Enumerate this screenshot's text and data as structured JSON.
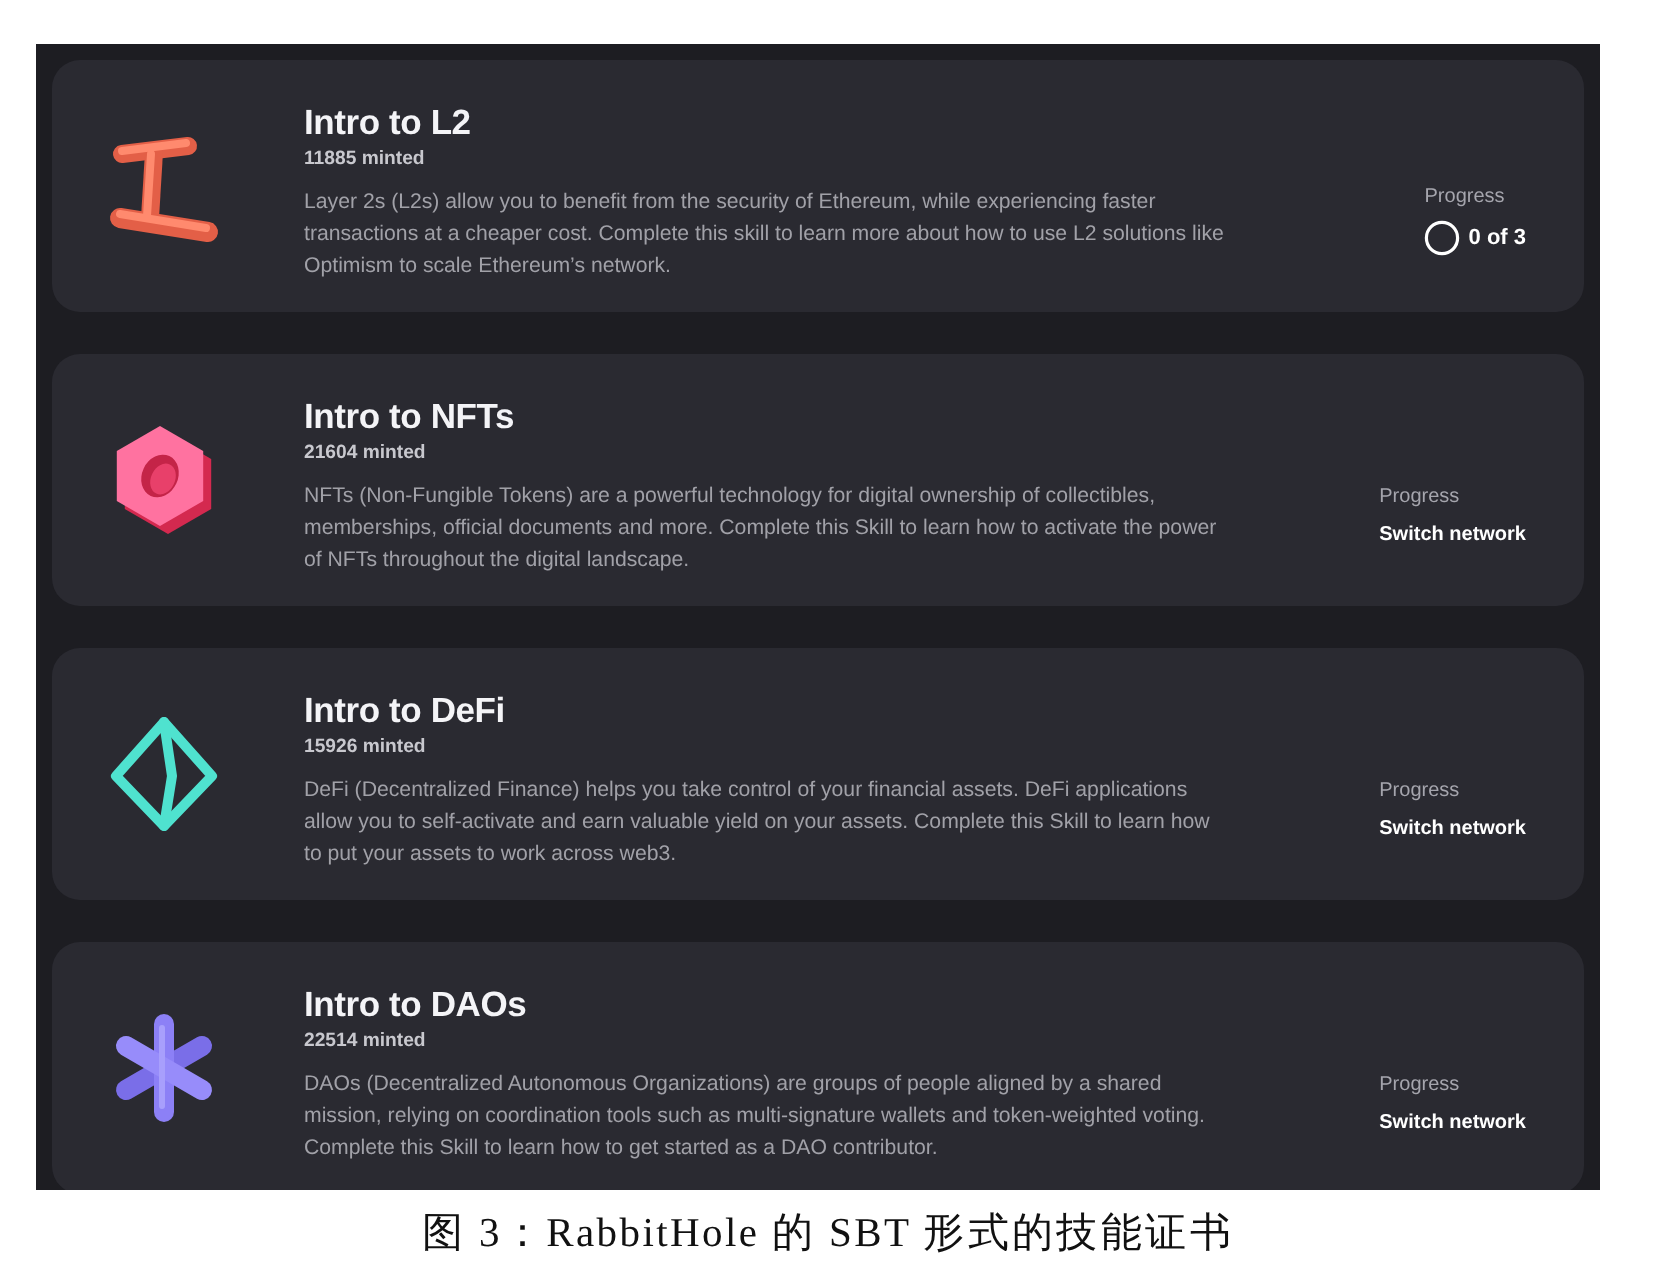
{
  "skills": [
    {
      "title": "Intro to L2",
      "minted": "11885 minted",
      "description": "Layer 2s (L2s) allow you to benefit from the security of Ethereum, while experiencing faster transactions at a cheaper cost. Complete this skill to learn more about how to use L2 solutions like Optimism to scale Ethereum’s network.",
      "progress_label": "Progress",
      "status": {
        "kind": "count",
        "text": "0 of 3"
      }
    },
    {
      "title": "Intro to NFTs",
      "minted": "21604 minted",
      "description": "NFTs (Non-Fungible Tokens) are a powerful technology for digital ownership of collectibles, memberships, official documents and more. Complete this Skill to learn how to activate the power of NFTs throughout the digital landscape.",
      "progress_label": "Progress",
      "status": {
        "kind": "network",
        "text": "Switch network"
      }
    },
    {
      "title": "Intro to DeFi",
      "minted": "15926 minted",
      "description": "DeFi (Decentralized Finance) helps you take control of your financial assets. DeFi applications allow you to self-activate and earn valuable yield on your assets. Complete this Skill to learn how to put your assets to work across web3.",
      "progress_label": "Progress",
      "status": {
        "kind": "network",
        "text": "Switch network"
      }
    },
    {
      "title": "Intro to DAOs",
      "minted": "22514 minted",
      "description": "DAOs (Decentralized Autonomous Organizations) are groups of people aligned by a shared mission, relying on coordination tools such as multi-signature wallets and token-weighted voting. Complete this Skill to learn how to get started as a DAO contributor.",
      "progress_label": "Progress",
      "status": {
        "kind": "network",
        "text": "Switch network"
      }
    }
  ],
  "caption": "图 3：RabbitHole 的 SBT 形式的技能证书"
}
